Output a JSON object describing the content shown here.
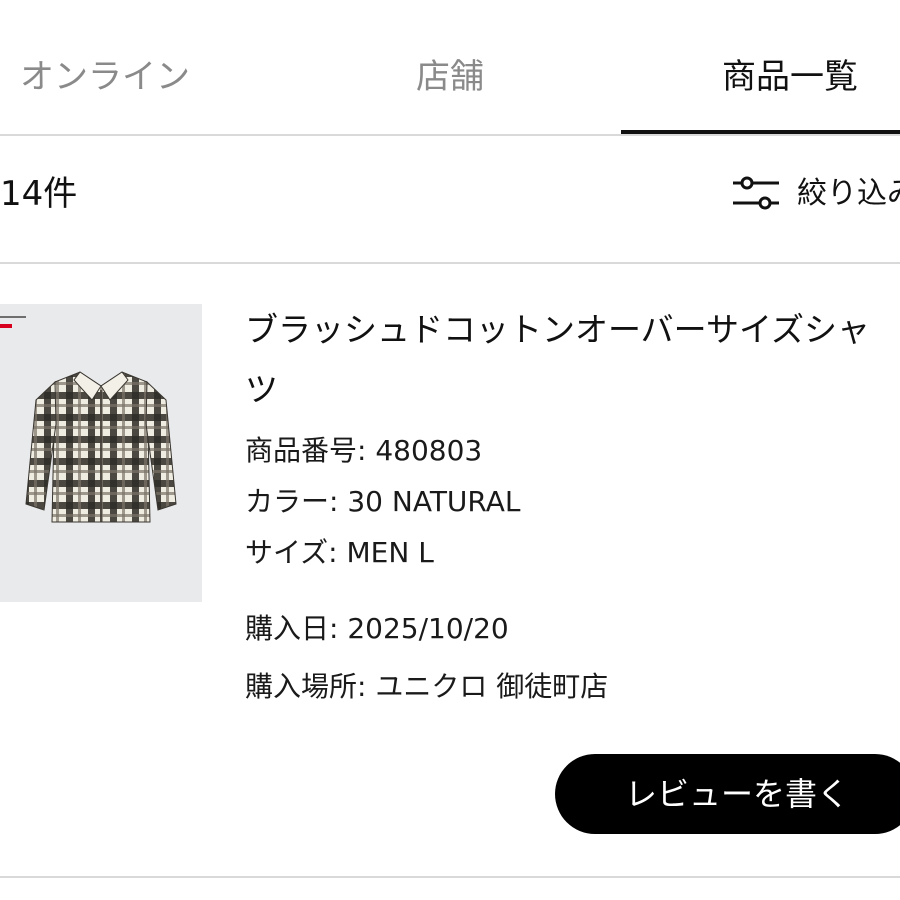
{
  "tabs": {
    "online": "オンライン",
    "store": "店舗",
    "products": "商品一覧",
    "active": "products"
  },
  "results": {
    "count": "14件",
    "filter_label": "絞り込み"
  },
  "product": {
    "name": "ブラッシュドコットンオーバーサイズシャツ",
    "number_label": "商品番号",
    "number": "480803",
    "color_label": "カラー",
    "color": "30 NATURAL",
    "size_label": "サイズ",
    "size": "MEN L",
    "purchase_date_label": "購入日",
    "purchase_date": "2025/10/20",
    "purchase_place_label": "購入場所",
    "purchase_place": "ユニクロ 御徒町店",
    "image_icon": "plaid-shirt-product-image"
  },
  "actions": {
    "write_review": "レビューを書く"
  },
  "colors": {
    "accent": "#000000",
    "inactive_tab": "#8a8a8a",
    "divider": "#d9d9d9",
    "thumb_bg": "#e9eaec",
    "brand_red": "#d8001f"
  }
}
